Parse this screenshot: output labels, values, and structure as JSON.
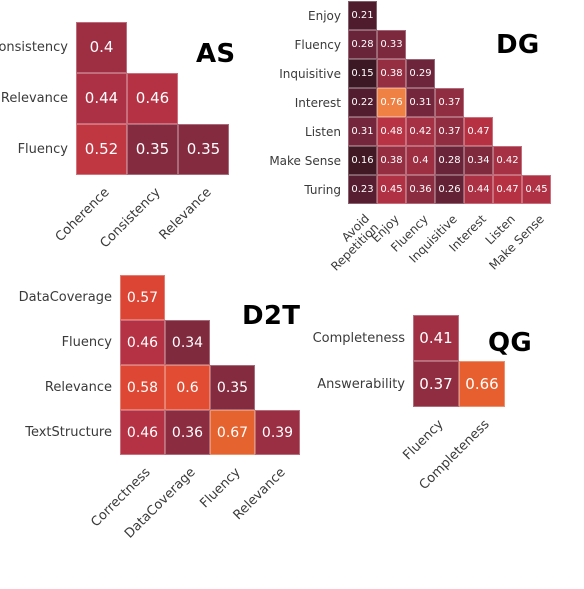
{
  "figure": {
    "background": "#ffffff",
    "text_color": "#3a3a3a",
    "cell_text_color": "#ffffff"
  },
  "chart_data": [
    {
      "id": "AS",
      "type": "heatmap",
      "title": "AS",
      "shape": "lower-triangle",
      "xlabel": "",
      "ylabel": "",
      "x_categories": [
        "Coherence",
        "Consistency",
        "Relevance"
      ],
      "y_categories": [
        "Consistency",
        "Relevance",
        "Fluency"
      ],
      "matrix": [
        [
          0.4,
          null,
          null
        ],
        [
          0.44,
          0.46,
          null
        ],
        [
          0.52,
          0.35,
          0.35
        ]
      ],
      "cells": [
        {
          "row": 0,
          "col": 0,
          "value": 0.4,
          "label": "0.4",
          "color": "#9E2F43"
        },
        {
          "row": 1,
          "col": 0,
          "value": 0.44,
          "label": "0.44",
          "color": "#AD3144"
        },
        {
          "row": 1,
          "col": 1,
          "value": 0.46,
          "label": "0.46",
          "color": "#B43243"
        },
        {
          "row": 2,
          "col": 0,
          "value": 0.52,
          "label": "0.52",
          "color": "#C03742"
        },
        {
          "row": 2,
          "col": 1,
          "value": 0.35,
          "label": "0.35",
          "color": "#842B3F"
        },
        {
          "row": 2,
          "col": 2,
          "value": 0.35,
          "label": "0.35",
          "color": "#842B3F"
        }
      ]
    },
    {
      "id": "DG",
      "type": "heatmap",
      "title": "DG",
      "shape": "lower-triangle",
      "xlabel": "",
      "ylabel": "",
      "x_categories": [
        "Avoid\nRepetition",
        "Enjoy",
        "Fluency",
        "Inquisitive",
        "Interest",
        "Listen",
        "Make Sense"
      ],
      "y_categories": [
        "Enjoy",
        "Fluency",
        "Inquisitive",
        "Interest",
        "Listen",
        "Make Sense",
        "Turing"
      ],
      "matrix": [
        [
          0.21,
          null,
          null,
          null,
          null,
          null,
          null
        ],
        [
          0.28,
          0.33,
          null,
          null,
          null,
          null,
          null
        ],
        [
          0.15,
          0.38,
          0.29,
          null,
          null,
          null,
          null
        ],
        [
          0.22,
          0.76,
          0.31,
          0.37,
          null,
          null,
          null
        ],
        [
          0.31,
          0.48,
          0.42,
          0.37,
          0.47,
          null,
          null
        ],
        [
          0.16,
          0.38,
          0.4,
          0.28,
          0.34,
          0.42,
          null
        ],
        [
          0.23,
          0.45,
          0.36,
          0.26,
          0.44,
          0.47,
          0.45
        ]
      ],
      "cells": [
        {
          "row": 0,
          "col": 0,
          "value": 0.21,
          "label": "0.21",
          "color": "#4E1C2D"
        },
        {
          "row": 1,
          "col": 0,
          "value": 0.28,
          "label": "0.28",
          "color": "#6A243A"
        },
        {
          "row": 1,
          "col": 1,
          "value": 0.33,
          "label": "0.33",
          "color": "#7C293E"
        },
        {
          "row": 2,
          "col": 0,
          "value": 0.15,
          "label": "0.15",
          "color": "#3C1824"
        },
        {
          "row": 2,
          "col": 1,
          "value": 0.38,
          "label": "0.38",
          "color": "#962E42"
        },
        {
          "row": 2,
          "col": 2,
          "value": 0.29,
          "label": "0.29",
          "color": "#6D253B"
        },
        {
          "row": 3,
          "col": 0,
          "value": 0.22,
          "label": "0.22",
          "color": "#521D2E"
        },
        {
          "row": 3,
          "col": 1,
          "value": 0.76,
          "label": "0.76",
          "color": "#EE8143"
        },
        {
          "row": 3,
          "col": 2,
          "value": 0.31,
          "label": "0.31",
          "color": "#74263C"
        },
        {
          "row": 3,
          "col": 3,
          "value": 0.37,
          "label": "0.37",
          "color": "#902D41"
        },
        {
          "row": 4,
          "col": 0,
          "value": 0.31,
          "label": "0.31",
          "color": "#74263C"
        },
        {
          "row": 4,
          "col": 1,
          "value": 0.48,
          "label": "0.48",
          "color": "#B83343"
        },
        {
          "row": 4,
          "col": 2,
          "value": 0.42,
          "label": "0.42",
          "color": "#A63044"
        },
        {
          "row": 4,
          "col": 3,
          "value": 0.37,
          "label": "0.37",
          "color": "#902D41"
        },
        {
          "row": 4,
          "col": 4,
          "value": 0.47,
          "label": "0.47",
          "color": "#B63243"
        },
        {
          "row": 5,
          "col": 0,
          "value": 0.16,
          "label": "0.16",
          "color": "#401925"
        },
        {
          "row": 5,
          "col": 1,
          "value": 0.38,
          "label": "0.38",
          "color": "#962E42"
        },
        {
          "row": 5,
          "col": 2,
          "value": 0.4,
          "label": "0.4",
          "color": "#9E2F43"
        },
        {
          "row": 5,
          "col": 3,
          "value": 0.28,
          "label": "0.28",
          "color": "#6A243A"
        },
        {
          "row": 5,
          "col": 4,
          "value": 0.34,
          "label": "0.34",
          "color": "#802A3E"
        },
        {
          "row": 5,
          "col": 5,
          "value": 0.42,
          "label": "0.42",
          "color": "#A63044"
        },
        {
          "row": 6,
          "col": 0,
          "value": 0.23,
          "label": "0.23",
          "color": "#561E30"
        },
        {
          "row": 6,
          "col": 1,
          "value": 0.45,
          "label": "0.45",
          "color": "#B03144"
        },
        {
          "row": 6,
          "col": 2,
          "value": 0.36,
          "label": "0.36",
          "color": "#8C2C40"
        },
        {
          "row": 6,
          "col": 3,
          "value": 0.26,
          "label": "0.26",
          "color": "#632236"
        },
        {
          "row": 6,
          "col": 4,
          "value": 0.44,
          "label": "0.44",
          "color": "#AD3144"
        },
        {
          "row": 6,
          "col": 5,
          "value": 0.47,
          "label": "0.47",
          "color": "#B63243"
        },
        {
          "row": 6,
          "col": 6,
          "value": 0.45,
          "label": "0.45",
          "color": "#B03144"
        }
      ]
    },
    {
      "id": "D2T",
      "type": "heatmap",
      "title": "D2T",
      "shape": "lower-triangle",
      "xlabel": "",
      "ylabel": "",
      "x_categories": [
        "Correctness",
        "DataCoverage",
        "Fluency",
        "Relevance"
      ],
      "y_categories": [
        "DataCoverage",
        "Fluency",
        "Relevance",
        "TextStructure"
      ],
      "matrix": [
        [
          0.57,
          null,
          null,
          null
        ],
        [
          0.46,
          0.34,
          null,
          null
        ],
        [
          0.58,
          0.6,
          0.35,
          null
        ],
        [
          0.46,
          0.36,
          0.67,
          0.39
        ]
      ],
      "cells": [
        {
          "row": 0,
          "col": 0,
          "value": 0.57,
          "label": "0.57",
          "color": "#DC4434"
        },
        {
          "row": 1,
          "col": 0,
          "value": 0.46,
          "label": "0.46",
          "color": "#B43243"
        },
        {
          "row": 1,
          "col": 1,
          "value": 0.34,
          "label": "0.34",
          "color": "#802A3E"
        },
        {
          "row": 2,
          "col": 0,
          "value": 0.58,
          "label": "0.58",
          "color": "#DE4733"
        },
        {
          "row": 2,
          "col": 1,
          "value": 0.6,
          "label": "0.6",
          "color": "#E14C32"
        },
        {
          "row": 2,
          "col": 2,
          "value": 0.35,
          "label": "0.35",
          "color": "#842B3F"
        },
        {
          "row": 3,
          "col": 0,
          "value": 0.46,
          "label": "0.46",
          "color": "#B43243"
        },
        {
          "row": 3,
          "col": 1,
          "value": 0.36,
          "label": "0.36",
          "color": "#8C2C40"
        },
        {
          "row": 3,
          "col": 2,
          "value": 0.67,
          "label": "0.67",
          "color": "#E4632F"
        },
        {
          "row": 3,
          "col": 3,
          "value": 0.39,
          "label": "0.39",
          "color": "#9A2E43"
        }
      ]
    },
    {
      "id": "QG",
      "type": "heatmap",
      "title": "QG",
      "shape": "lower-triangle",
      "xlabel": "",
      "ylabel": "",
      "x_categories": [
        "Fluency",
        "Completeness"
      ],
      "y_categories": [
        "Completeness",
        "Answerability"
      ],
      "matrix": [
        [
          0.41,
          null
        ],
        [
          0.37,
          0.66
        ]
      ],
      "cells": [
        {
          "row": 0,
          "col": 0,
          "value": 0.41,
          "label": "0.41",
          "color": "#A23044"
        },
        {
          "row": 1,
          "col": 0,
          "value": 0.37,
          "label": "0.37",
          "color": "#902D41"
        },
        {
          "row": 1,
          "col": 1,
          "value": 0.66,
          "label": "0.66",
          "color": "#E75F2E"
        }
      ]
    }
  ]
}
